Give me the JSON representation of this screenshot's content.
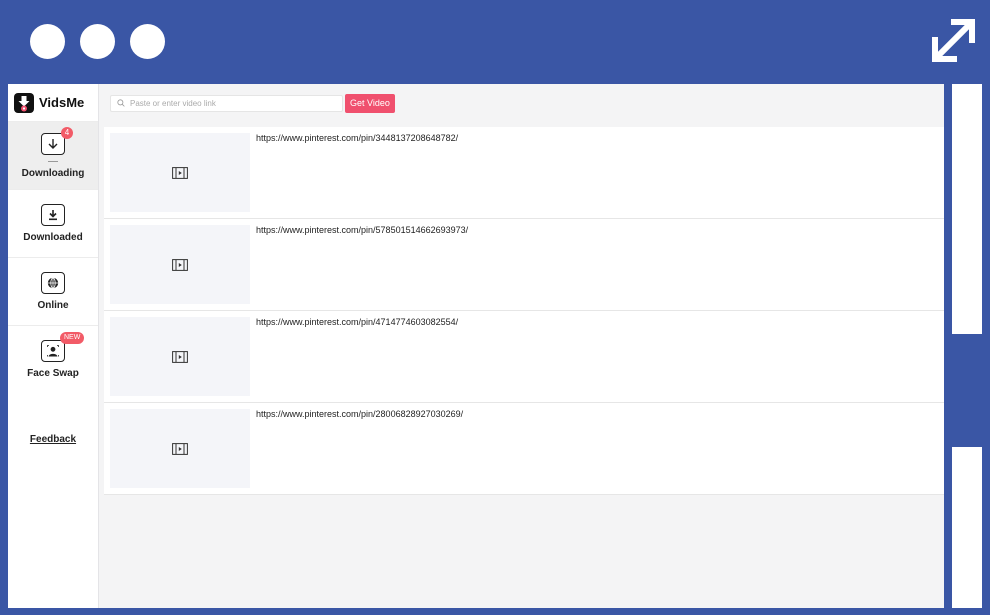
{
  "app": {
    "name": "VidsMe",
    "icons": {
      "logo": "vidsme-logo-icon",
      "expand": "expand-icon"
    },
    "accent_color": "#f0506e",
    "frame_color": "#3a56a5"
  },
  "sidebar": {
    "items": [
      {
        "label": "Downloading",
        "icon": "download-arrow-icon",
        "badge": "4",
        "active": true
      },
      {
        "label": "Downloaded",
        "icon": "download-tray-icon"
      },
      {
        "label": "Online",
        "icon": "globe-icon"
      },
      {
        "label": "Face Swap",
        "icon": "face-swap-icon",
        "badge": "NEW"
      }
    ],
    "feedback": "Feedback"
  },
  "toolbar": {
    "search_placeholder": "Paste or enter video link",
    "search_value": "",
    "get_video_label": "Get Video"
  },
  "downloads": [
    {
      "url": "https://www.pinterest.com/pin/3448137208648782/",
      "thumb_icon": "video-film-icon"
    },
    {
      "url": "https://www.pinterest.com/pin/578501514662693973/",
      "thumb_icon": "video-film-icon"
    },
    {
      "url": "https://www.pinterest.com/pin/4714774603082554/",
      "thumb_icon": "video-film-icon"
    },
    {
      "url": "https://www.pinterest.com/pin/28006828927030269/",
      "thumb_icon": "video-film-icon"
    }
  ]
}
